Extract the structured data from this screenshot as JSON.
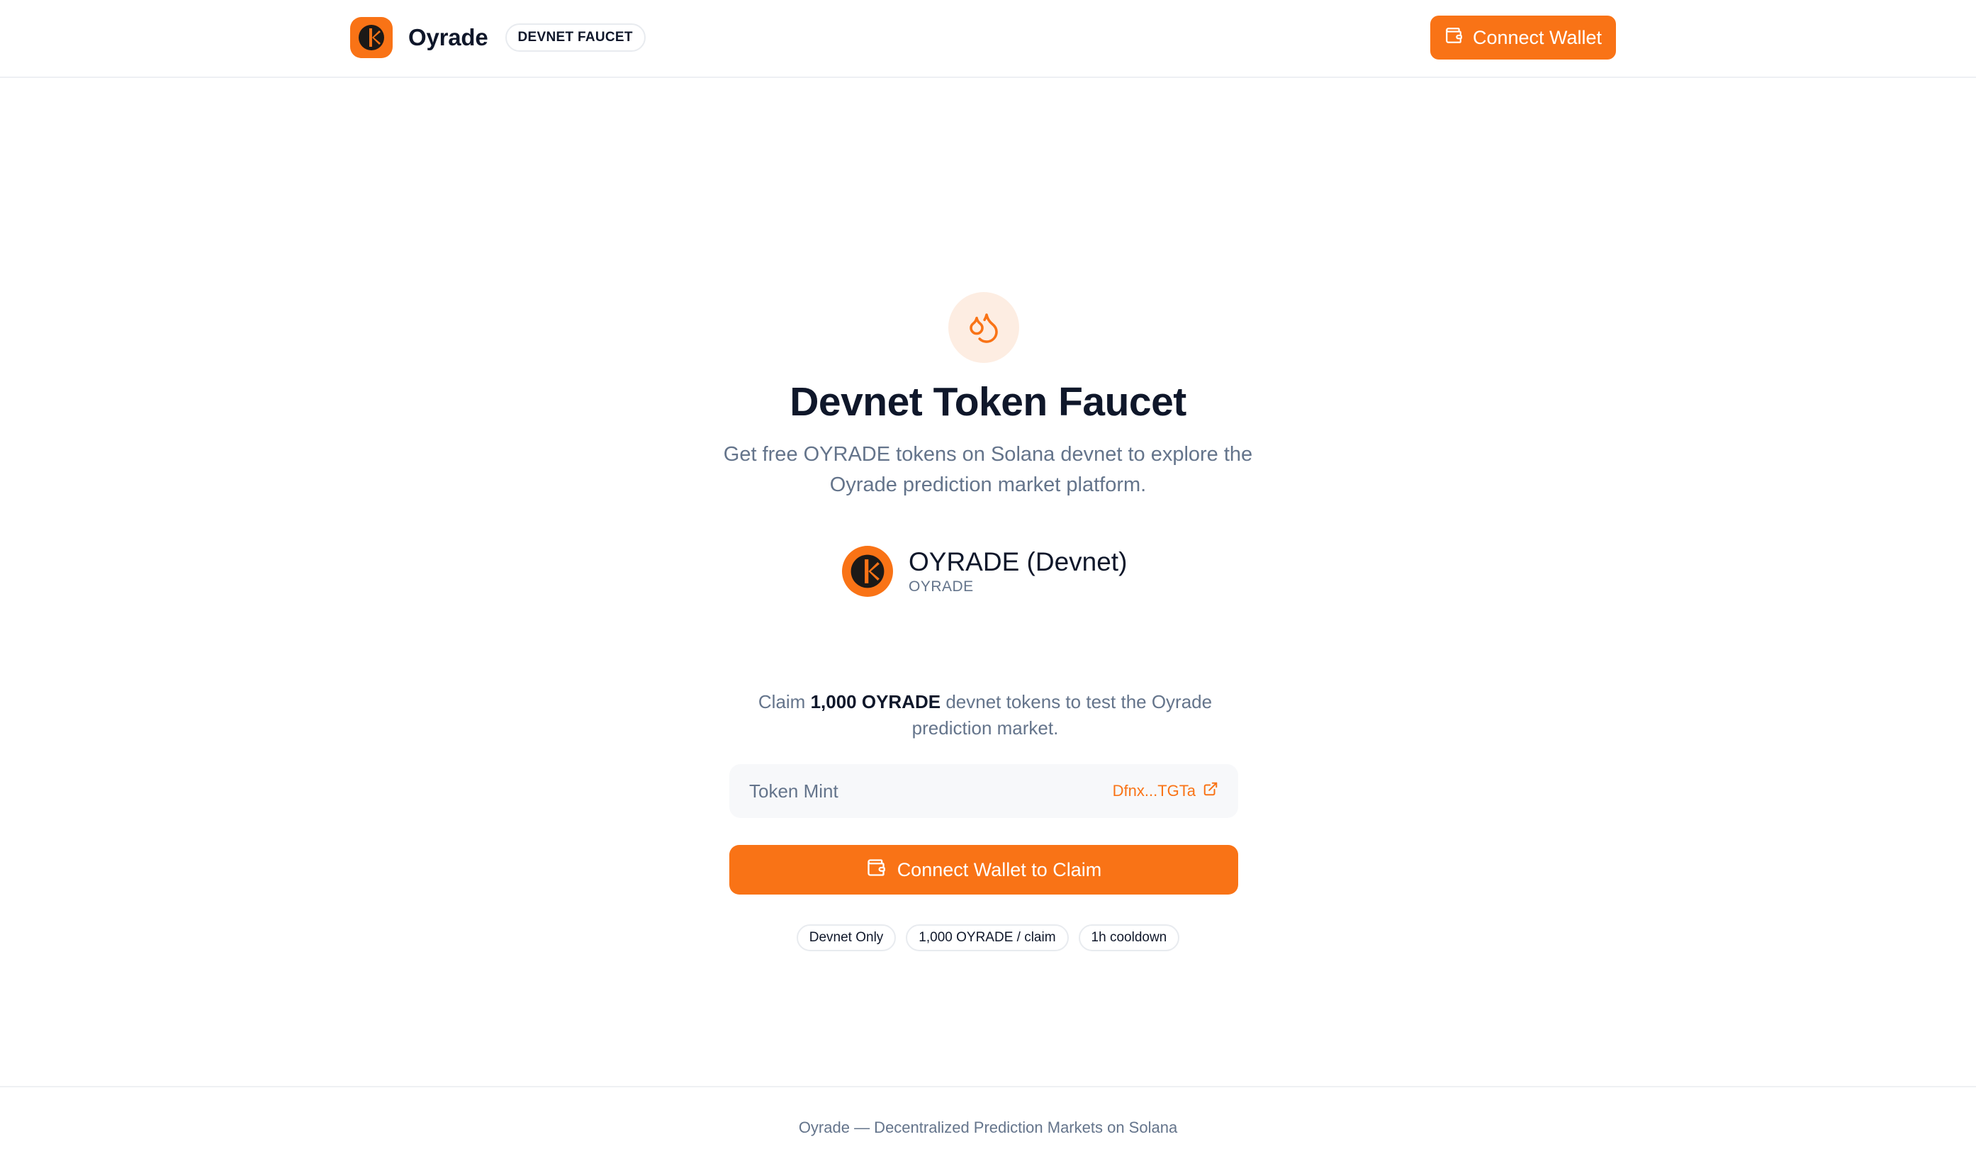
{
  "header": {
    "brand_name": "Oyrade",
    "badge": "DEVNET FAUCET",
    "connect_label": "Connect Wallet"
  },
  "hero": {
    "icon": "droplets-icon",
    "title": "Devnet Token Faucet",
    "subtitle": "Get free OYRADE tokens on Solana devnet to explore the Oyrade prediction market platform."
  },
  "token": {
    "name": "OYRADE (Devnet)",
    "symbol": "OYRADE"
  },
  "claim": {
    "prefix": "Claim ",
    "amount": "1,000 OYRADE",
    "suffix": " devnet tokens to test the Oyrade prediction market."
  },
  "mint": {
    "label": "Token Mint",
    "address": "Dfnx...TGTa"
  },
  "claim_button": {
    "label": "Connect Wallet to Claim"
  },
  "pills": [
    "Devnet Only",
    "1,000 OYRADE / claim",
    "1h cooldown"
  ],
  "footer": {
    "text": "Oyrade — Decentralized Prediction Markets on Solana"
  },
  "colors": {
    "accent": "#f97316",
    "accent_soft": "#fdede2",
    "text_primary": "#0f172a",
    "text_muted": "#64748b"
  }
}
